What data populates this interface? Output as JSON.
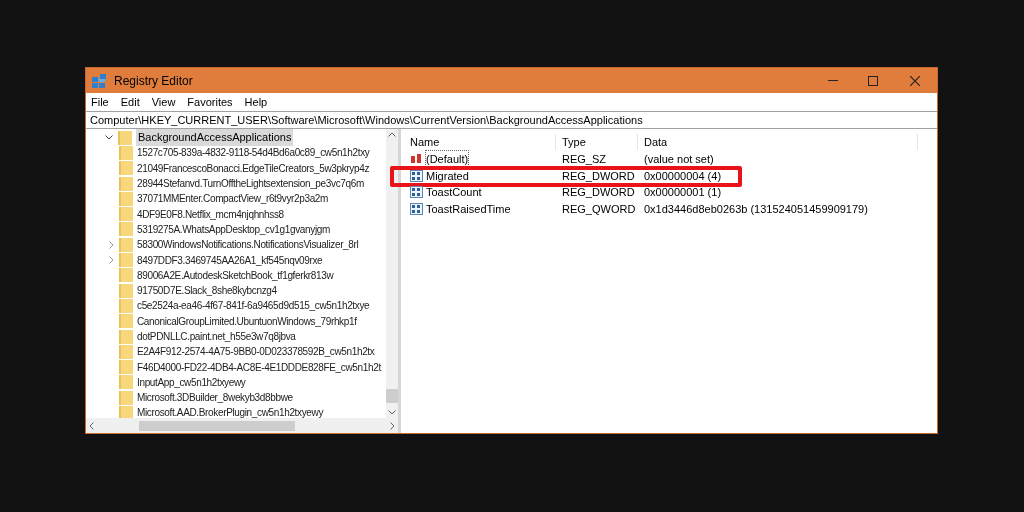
{
  "window": {
    "title": "Registry Editor"
  },
  "menu": [
    "File",
    "Edit",
    "View",
    "Favorites",
    "Help"
  ],
  "address": "Computer\\HKEY_CURRENT_USER\\Software\\Microsoft\\Windows\\CurrentVersion\\BackgroundAccessApplications",
  "tree": {
    "label": "BackgroundAccessApplications",
    "expanded": true,
    "selected": true,
    "children": [
      {
        "label": "1527c705-839a-4832-9118-54d4Bd6a0c89_cw5n1h2txy",
        "has_children": false
      },
      {
        "label": "21049FrancescoBonacci.EdgeTileCreators_5w3pkryp4z",
        "has_children": false
      },
      {
        "label": "28944Stefanvd.TurnOfftheLightsextension_pe3vc7q6m",
        "has_children": false
      },
      {
        "label": "37071MMEnter.CompactView_r6t9vyr2p3a2m",
        "has_children": false
      },
      {
        "label": "4DF9E0F8.Netflix_mcm4njqhnhss8",
        "has_children": false
      },
      {
        "label": "5319275A.WhatsAppDesktop_cv1g1gvanyjgm",
        "has_children": false
      },
      {
        "label": "58300WindowsNotifications.NotificationsVisualizer_8rl",
        "has_children": true
      },
      {
        "label": "8497DDF3.3469745AA26A1_kf545nqv09rxe",
        "has_children": true
      },
      {
        "label": "89006A2E.AutodeskSketchBook_tf1gferkr813w",
        "has_children": false
      },
      {
        "label": "91750D7E.Slack_8she8kybcnzg4",
        "has_children": false
      },
      {
        "label": "c5e2524a-ea46-4f67-841f-6a9465d9d515_cw5n1h2txye",
        "has_children": false
      },
      {
        "label": "CanonicalGroupLimited.UbuntuonWindows_79rhkp1f",
        "has_children": false
      },
      {
        "label": "dotPDNLLC.paint.net_h55e3w7q8jbva",
        "has_children": false
      },
      {
        "label": "E2A4F912-2574-4A75-9BB0-0D023378592B_cw5n1h2tx",
        "has_children": false
      },
      {
        "label": "F46D4000-FD22-4DB4-AC8E-4E1DDDE828FE_cw5n1h2t",
        "has_children": false
      },
      {
        "label": "InputApp_cw5n1h2txyewy",
        "has_children": false
      },
      {
        "label": "Microsoft.3DBuilder_8wekyb3d8bbwe",
        "has_children": false
      },
      {
        "label": "Microsoft.AAD.BrokerPlugin_cw5n1h2txyewy",
        "has_children": false
      }
    ]
  },
  "table": {
    "columns": [
      "Name",
      "Type",
      "Data"
    ],
    "rows": [
      {
        "kind": "string",
        "name": "(Default)",
        "type": "REG_SZ",
        "data": "(value not set)",
        "highlighted": false
      },
      {
        "kind": "binary",
        "name": "Migrated",
        "type": "REG_DWORD",
        "data": "0x00000004 (4)",
        "highlighted": true
      },
      {
        "kind": "binary",
        "name": "ToastCount",
        "type": "REG_DWORD",
        "data": "0x00000001 (1)",
        "highlighted": false
      },
      {
        "kind": "binary",
        "name": "ToastRaisedTime",
        "type": "REG_QWORD",
        "data": "0x1d3446d8eb0263b (131524051459909179)",
        "highlighted": false
      }
    ]
  }
}
